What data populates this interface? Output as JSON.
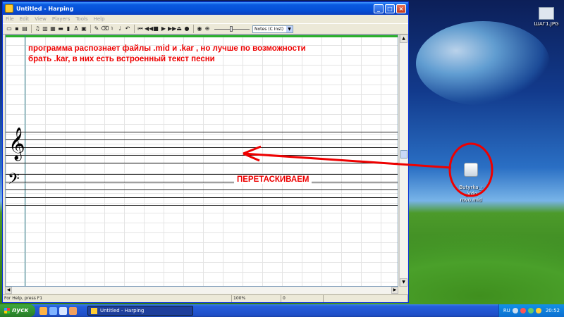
{
  "desktop": {
    "icons": [
      {
        "label": "ШАГ1.JPG"
      },
      {
        "label": "Butyrka_-_Vdo\nrovo.mid"
      }
    ]
  },
  "window": {
    "title": "Untitled - Harping",
    "min": "_",
    "max": "□",
    "close": "×",
    "menu": [
      "File",
      "Edit",
      "View",
      "Players",
      "Tools",
      "Help"
    ],
    "combo_value": "Notes (C Inst)",
    "status": {
      "help": "For Help, press F1",
      "zoom": "100%",
      "value": "0"
    }
  },
  "annotations": {
    "line1": "программа распознает файлы  .mid  и  .kar , но лучше по возможности",
    "line2": "брать .kar, в них есть встроенный текст песни",
    "drag": "ПЕРЕТАСКИВАЕМ",
    "color": "#e00000"
  },
  "taskbar": {
    "start": "пуск",
    "task": "Untitled - Harping",
    "lang": "RU",
    "clock": "20:52"
  }
}
